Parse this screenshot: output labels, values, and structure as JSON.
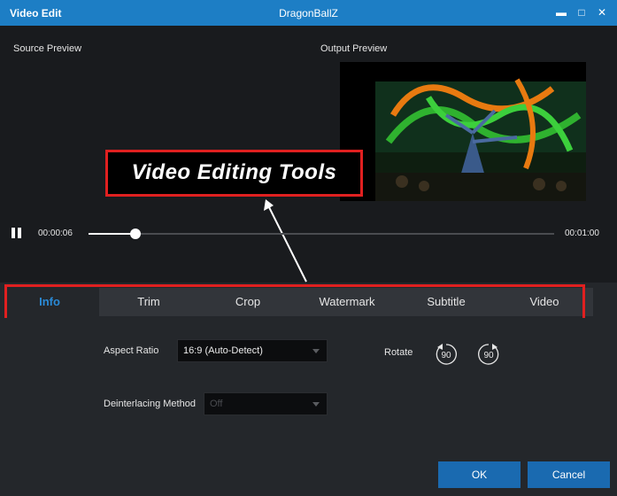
{
  "window": {
    "app_title": "Video Edit",
    "file_name": "DragonBallZ",
    "controls": {
      "minimize": "▬",
      "maximize": "□",
      "close": "✕"
    }
  },
  "preview": {
    "source_label": "Source Preview",
    "output_label": "Output Preview"
  },
  "annotation": {
    "callout_text": "Video Editing Tools"
  },
  "player": {
    "current_time": "00:00:06",
    "total_time": "00:01:00",
    "progress": 0.1
  },
  "tabs": [
    {
      "label": "Info",
      "active": true
    },
    {
      "label": "Trim",
      "active": false
    },
    {
      "label": "Crop",
      "active": false
    },
    {
      "label": "Watermark",
      "active": false
    },
    {
      "label": "Subtitle",
      "active": false
    },
    {
      "label": "Video",
      "active": false
    }
  ],
  "info_panel": {
    "aspect_ratio_label": "Aspect Ratio",
    "aspect_ratio_value": "16:9 (Auto-Detect)",
    "deinterlace_label": "Deinterlacing Method",
    "deinterlace_value": "Off",
    "rotate_label": "Rotate",
    "rotate_left_value": "90",
    "rotate_right_value": "90"
  },
  "footer": {
    "ok_label": "OK",
    "cancel_label": "Cancel"
  },
  "colors": {
    "titlebar": "#1d7ec5",
    "accent": "#2a8ad6",
    "highlight_border": "#e02020",
    "button": "#1a6ab0"
  }
}
